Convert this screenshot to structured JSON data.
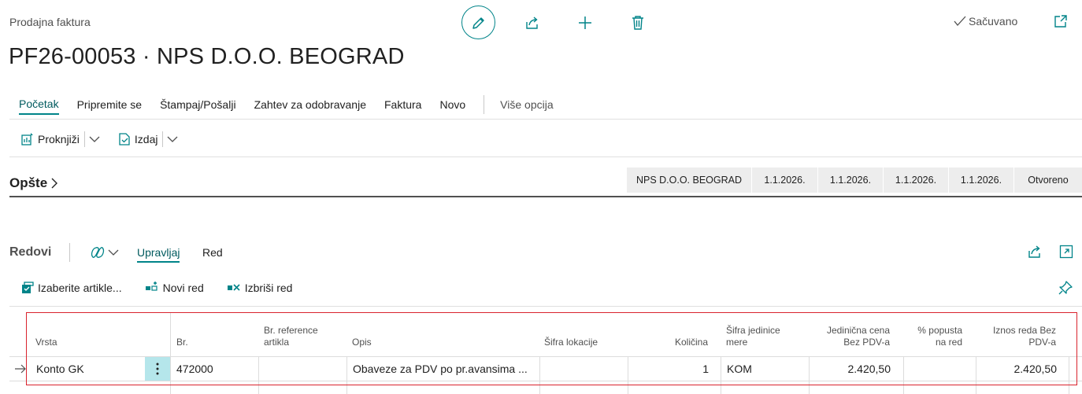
{
  "header": {
    "breadcrumb": "Prodajna faktura",
    "title": "PF26-00053 · NPS D.O.O. BEOGRAD",
    "saved_status": "Sačuvano"
  },
  "tabs": [
    {
      "label": "Početak"
    },
    {
      "label": "Pripremite se"
    },
    {
      "label": "Štampaj/Pošalji"
    },
    {
      "label": "Zahtev za odobravanje"
    },
    {
      "label": "Faktura"
    },
    {
      "label": "Novo"
    }
  ],
  "more_options": "Više opcija",
  "actions": {
    "post": "Proknjiži",
    "release": "Izdaj"
  },
  "general": {
    "title": "Opšte",
    "summary": [
      "NPS D.O.O. BEOGRAD",
      "1.1.2026.",
      "1.1.2026.",
      "1.1.2026.",
      "1.1.2026.",
      "Otvoreno"
    ]
  },
  "lines": {
    "title": "Redovi",
    "tab_manage": "Upravljaj",
    "tab_line": "Red",
    "actions": {
      "select_items": "Izaberite artikle...",
      "new_line": "Novi red",
      "delete_line": "Izbriši red"
    },
    "columns": {
      "type": "Vrsta",
      "no": "Br.",
      "ref_1": "Br. reference",
      "ref_2": "artikla",
      "description": "Opis",
      "location": "Šifra lokacije",
      "quantity": "Količina",
      "uom_1": "Šifra jedinice",
      "uom_2": "mere",
      "unit_price_1": "Jedinična cena",
      "unit_price_2": "Bez PDV-a",
      "discount_1": "% popusta",
      "discount_2": "na red",
      "amount_1": "Iznos reda Bez",
      "amount_2": "PDV-a"
    },
    "rows": [
      {
        "type": "Konto GK",
        "no": "472000",
        "reference": "",
        "description": "Obaveze za PDV po pr.avansima ...",
        "location": "",
        "quantity": "1",
        "uom": "KOM",
        "unit_price": "2.420,50",
        "discount": "",
        "amount": "2.420,50"
      }
    ]
  },
  "colors": {
    "accent": "#008489",
    "highlight_box": "#d9232d",
    "selected_cell": "#b5e6eb"
  }
}
